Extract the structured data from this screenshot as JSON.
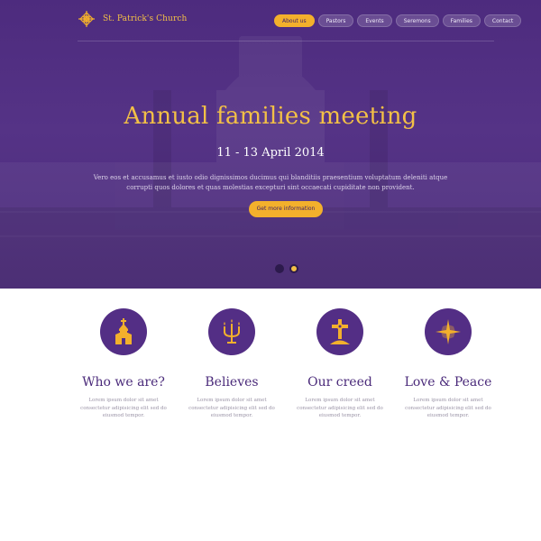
{
  "header": {
    "brand": "St. Patrick's Church",
    "logo_icon": "cross-emblem-icon"
  },
  "nav": {
    "items": [
      {
        "label": "About us",
        "active": true
      },
      {
        "label": "Pastors",
        "active": false
      },
      {
        "label": "Events",
        "active": false
      },
      {
        "label": "Seremons",
        "active": false
      },
      {
        "label": "Families",
        "active": false
      },
      {
        "label": "Contact",
        "active": false
      }
    ]
  },
  "hero": {
    "title": "Annual families meeting",
    "date": "11 - 13 April 2014",
    "text": "Vero eos et accusamus et iusto odio dignissimos ducimus qui blanditiis praesentium voluptatum deleniti atque corrupti quos dolores et quas molestias excepturi sint occaecati cupiditate non provident.",
    "button": "Get more information",
    "slides": 2,
    "active_slide": 2
  },
  "features": [
    {
      "title": "Who we are?",
      "icon": "church-icon",
      "text": "Lorem ipsum dolor sit amet consectetur adipisicing elit sed do eiusmod tempor."
    },
    {
      "title": "Believes",
      "icon": "candelabra-icon",
      "text": "Lorem ipsum dolor sit amet consectetur adipisicing elit sed do eiusmod tempor."
    },
    {
      "title": "Our creed",
      "icon": "cross-icon",
      "text": "Lorem ipsum dolor sit amet consectetur adipisicing elit sed do eiusmod tempor."
    },
    {
      "title": "Love & Peace",
      "icon": "star-icon",
      "text": "Lorem ipsum dolor sit amet consectetur adipisicing elit sed do eiusmod tempor."
    }
  ],
  "colors": {
    "primary": "#532e85",
    "accent": "#f3b02c",
    "title_gold": "#f3c046"
  }
}
